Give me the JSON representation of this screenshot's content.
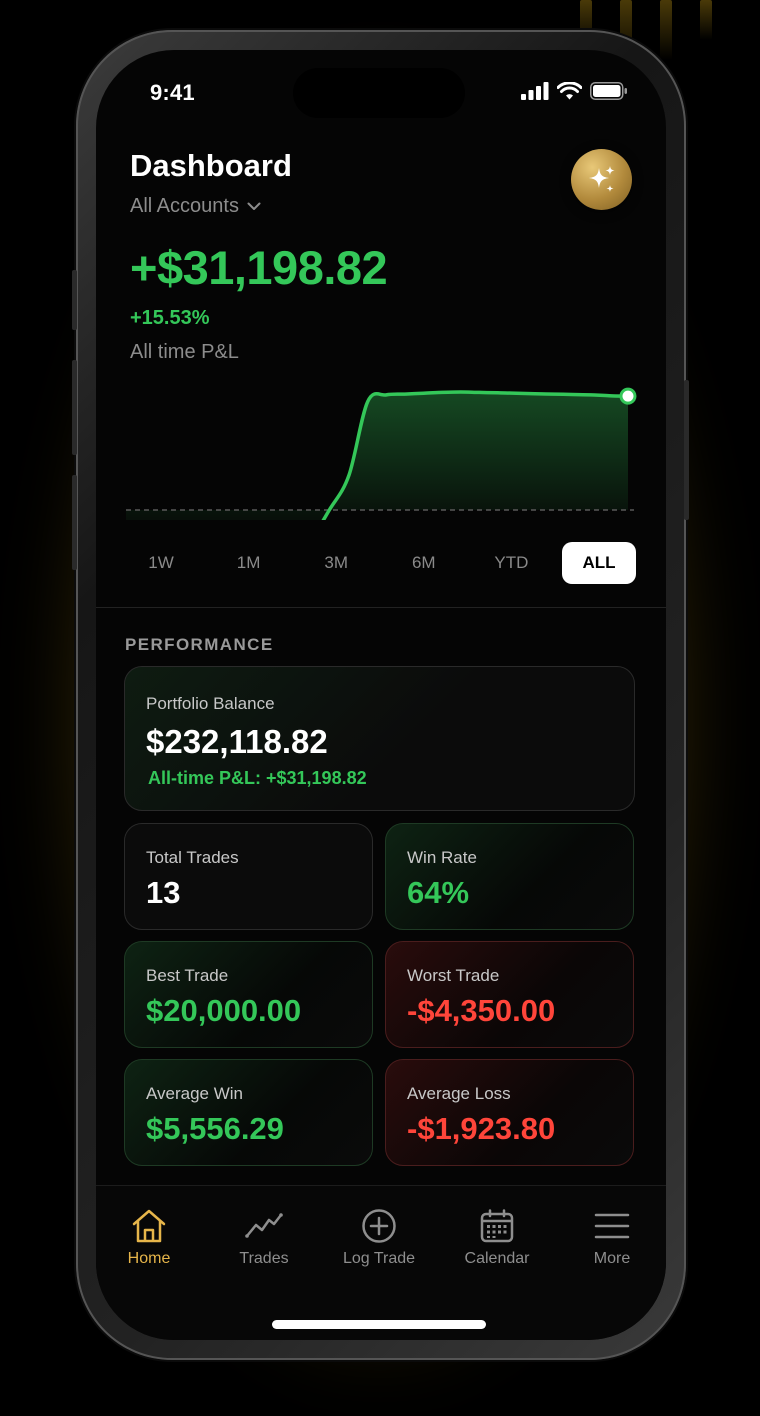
{
  "status_bar": {
    "time": "9:41"
  },
  "header": {
    "title": "Dashboard",
    "account_selector": "All Accounts"
  },
  "pnl": {
    "amount": "+$31,198.82",
    "percent": "+15.53%",
    "caption": "All time P&L"
  },
  "chart_data": {
    "type": "area",
    "x": [
      0,
      1,
      2,
      3,
      4,
      5,
      6,
      7,
      8,
      9,
      10,
      11,
      12,
      13,
      14,
      15,
      16,
      17,
      18,
      19,
      20,
      21,
      22,
      23,
      24,
      25,
      26,
      27
    ],
    "values": [
      0,
      1100,
      1150,
      1050,
      2400,
      1600,
      200,
      500,
      2300,
      2050,
      1050,
      4200,
      8200,
      17000,
      17800,
      17900,
      18000,
      18100,
      18150,
      18100,
      18050,
      18000,
      17950,
      17900,
      17850,
      17800,
      17700,
      17650
    ],
    "color": "#34c759",
    "baseline": "dashed"
  },
  "range_tabs": [
    "1W",
    "1M",
    "3M",
    "6M",
    "YTD",
    "ALL"
  ],
  "active_range": "ALL",
  "performance": {
    "section_label": "PERFORMANCE",
    "balance": {
      "label": "Portfolio Balance",
      "value": "$232,118.82",
      "sub": "All-time P&L: +$31,198.82"
    },
    "total_trades": {
      "label": "Total Trades",
      "value": "13"
    },
    "win_rate": {
      "label": "Win Rate",
      "value": "64%"
    },
    "best_trade": {
      "label": "Best Trade",
      "value": "$20,000.00"
    },
    "worst_trade": {
      "label": "Worst Trade",
      "value": "-$4,350.00"
    },
    "average_win": {
      "label": "Average Win",
      "value": "$5,556.29"
    },
    "average_loss": {
      "label": "Average Loss",
      "value": "-$1,923.80"
    }
  },
  "tabbar": {
    "home": "Home",
    "trades": "Trades",
    "log_trade": "Log Trade",
    "calendar": "Calendar",
    "more": "More"
  },
  "colors": {
    "positive": "#34c759",
    "negative": "#ff453a",
    "accent": "#e6b54a"
  }
}
